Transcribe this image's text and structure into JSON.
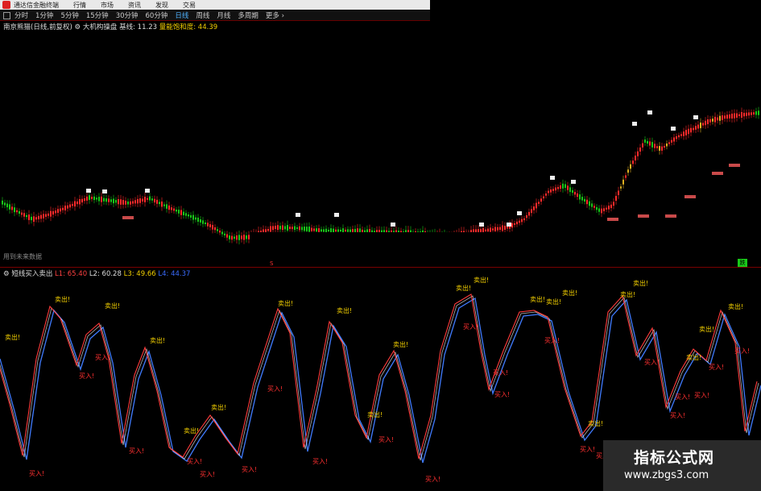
{
  "titlebar": {
    "app_title": "通达信金融终端",
    "menu": [
      "行情",
      "市场",
      "资讯",
      "发现",
      "交易"
    ]
  },
  "periods": {
    "items": [
      "分时",
      "1分钟",
      "5分钟",
      "15分钟",
      "30分钟",
      "60分钟",
      "日线",
      "周线",
      "月线",
      "多周期",
      "更多 ›"
    ],
    "active": "日线"
  },
  "main_pane": {
    "stock": "南京熊猫(日线,前复权)",
    "indicator": "大机构操盘",
    "base_label": "基线:",
    "base_value": "11.23",
    "sat_label": "量能饱和度:",
    "sat_value": "44.39",
    "future_note": "用到未来数据",
    "marker_s": "S",
    "marker_g": "跌"
  },
  "sub_pane": {
    "indicator": "短线买入卖出",
    "l1_label": "L1:",
    "l1_value": "65.40",
    "l2_label": "L2:",
    "l2_value": "60.28",
    "l3_label": "L3:",
    "l3_value": "49.66",
    "l4_label": "L4:",
    "l4_value": "44.37",
    "buy_label": "买入!",
    "sell_label": "卖出!",
    "colors": {
      "fast": "#ff3b3b",
      "slow": "#3f7bff",
      "sell": "#f3d000",
      "buy": "#ff3030"
    }
  },
  "watermark": {
    "title": "指标公式网",
    "url": "www.zbgs3.com"
  }
}
